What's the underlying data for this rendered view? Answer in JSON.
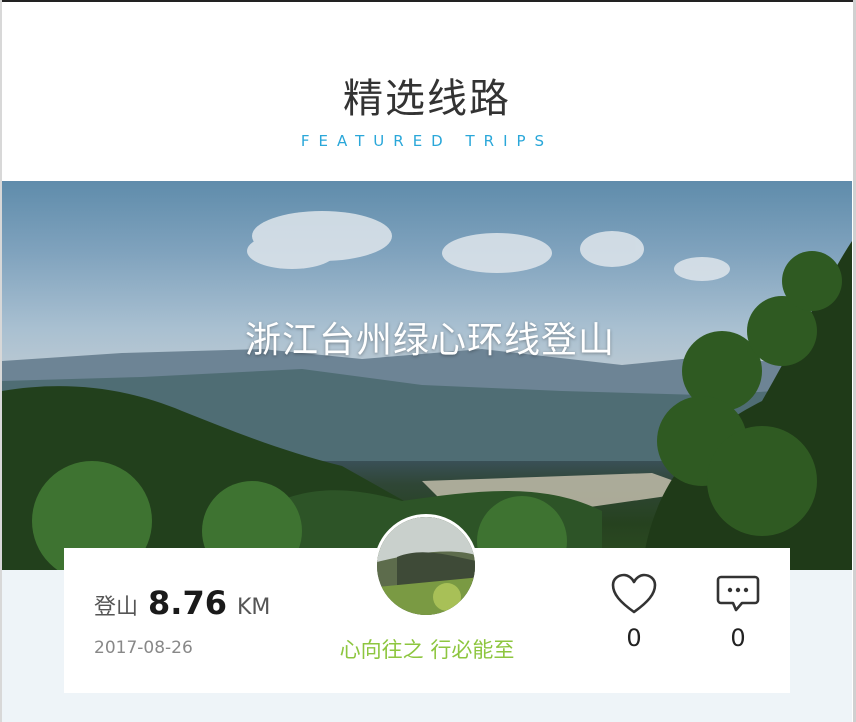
{
  "section": {
    "title": "精选线路",
    "subtitle": "FEATURED TRIPS"
  },
  "hero": {
    "title": "浙江台州绿心环线登山"
  },
  "route": {
    "type": "登山",
    "distance": "8.76",
    "unit": "KM",
    "date": "2017-08-26",
    "motto": "心向往之 行必能至"
  },
  "actions": {
    "likes": "0",
    "comments": "0"
  },
  "icons": {
    "like": "heart-icon",
    "comment": "comment-icon"
  },
  "colors": {
    "accent": "#2aa7d9",
    "motto": "#8dc63f",
    "card_bg": "#ffffff",
    "page_bg": "#eef4f8"
  }
}
